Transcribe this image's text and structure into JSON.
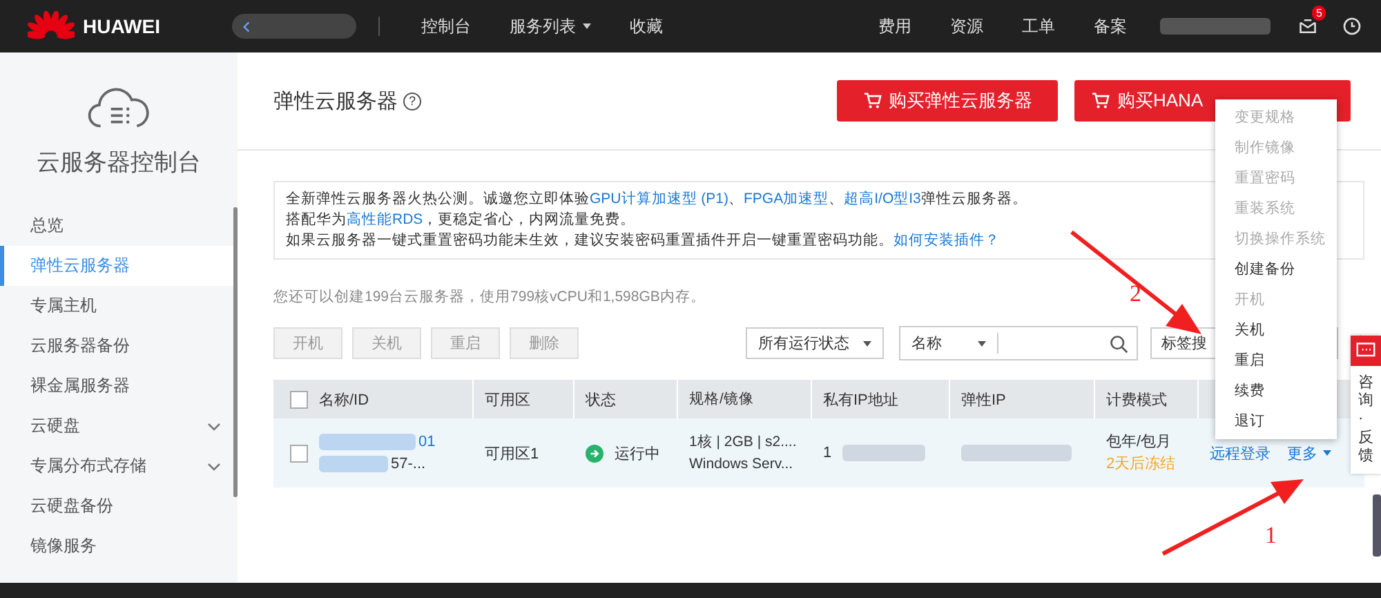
{
  "header": {
    "logo": "HUAWEI",
    "nav": [
      {
        "label": "控制台",
        "dropdown": false
      },
      {
        "label": "服务列表",
        "dropdown": true
      },
      {
        "label": "收藏",
        "dropdown": false
      }
    ],
    "links": [
      "费用",
      "资源",
      "工单",
      "备案"
    ],
    "message_badge": "5"
  },
  "sidebar": {
    "title": "云服务器控制台",
    "items": [
      {
        "label": "总览",
        "selected": false,
        "expandable": false
      },
      {
        "label": "弹性云服务器",
        "selected": true,
        "expandable": false
      },
      {
        "label": "专属主机",
        "selected": false,
        "expandable": false
      },
      {
        "label": "云服务器备份",
        "selected": false,
        "expandable": false
      },
      {
        "label": "裸金属服务器",
        "selected": false,
        "expandable": false
      },
      {
        "label": "云硬盘",
        "selected": false,
        "expandable": true
      },
      {
        "label": "专属分布式存储",
        "selected": false,
        "expandable": true
      },
      {
        "label": "云硬盘备份",
        "selected": false,
        "expandable": false
      },
      {
        "label": "镜像服务",
        "selected": false,
        "expandable": false
      }
    ]
  },
  "page_title": "弹性云服务器",
  "help_icon": "?",
  "buy_buttons": [
    "购买弹性云服务器",
    "购买HANA"
  ],
  "notice": [
    [
      {
        "text": "全新弹性云服务器火热公测。诚邀您立即体验",
        "link": false
      },
      {
        "text": "GPU计算加速型 (P1)",
        "link": true
      },
      {
        "text": "、",
        "link": false
      },
      {
        "text": "FPGA加速型",
        "link": true
      },
      {
        "text": "、",
        "link": false
      },
      {
        "text": "超高I/O型I3",
        "link": true
      },
      {
        "text": "弹性云服务器。",
        "link": false
      }
    ],
    [
      {
        "text": "搭配华为",
        "link": false
      },
      {
        "text": "高性能RDS",
        "link": true
      },
      {
        "text": "，更稳定省心，内网流量免费。",
        "link": false
      }
    ],
    [
      {
        "text": "如果云服务器一键式重置密码功能未生效，建议安装密码重置插件开启一键重置密码功能。",
        "link": false
      },
      {
        "text": "如何安装插件？",
        "link": true
      }
    ]
  ],
  "quota": "您还可以创建199台云服务器，使用799核vCPU和1,598GB内存。",
  "actions": [
    {
      "label": "开机",
      "disabled": true
    },
    {
      "label": "关机",
      "disabled": true
    },
    {
      "label": "重启",
      "disabled": true
    },
    {
      "label": "删除",
      "disabled": true
    }
  ],
  "filters": {
    "status": "所有运行状态",
    "field": "名称",
    "tag_search": "标签搜"
  },
  "table": {
    "header_checked": false,
    "columns": [
      "名称/ID",
      "可用区",
      "状态",
      "规格/镜像",
      "私有IP地址",
      "弹性IP",
      "计费模式"
    ],
    "rows": [
      {
        "checked": false,
        "name": "01",
        "id": "57-...",
        "zone": "可用区1",
        "status": {
          "kind": "running",
          "label": "运行中"
        },
        "spec": [
          "1核 | 2GB | s2....",
          "Windows Serv..."
        ],
        "private_ip": "1",
        "billing": "包年/包月",
        "expiry": "2天后冻结",
        "operations": [
          "远程登录",
          "更多"
        ]
      }
    ]
  },
  "more_menu": [
    {
      "label": "变更规格",
      "disabled": true
    },
    {
      "label": "制作镜像",
      "disabled": true
    },
    {
      "label": "重置密码",
      "disabled": true
    },
    {
      "label": "重装系统",
      "disabled": true
    },
    {
      "label": "切换操作系统",
      "disabled": true
    },
    {
      "label": "创建备份",
      "disabled": false
    },
    {
      "label": "开机",
      "disabled": true
    },
    {
      "label": "关机",
      "disabled": false
    },
    {
      "label": "重启",
      "disabled": false
    },
    {
      "label": "续费",
      "disabled": false
    },
    {
      "label": "退订",
      "disabled": false
    }
  ],
  "feedback": "咨询·反馈",
  "annotations": [
    "1",
    "2"
  ]
}
